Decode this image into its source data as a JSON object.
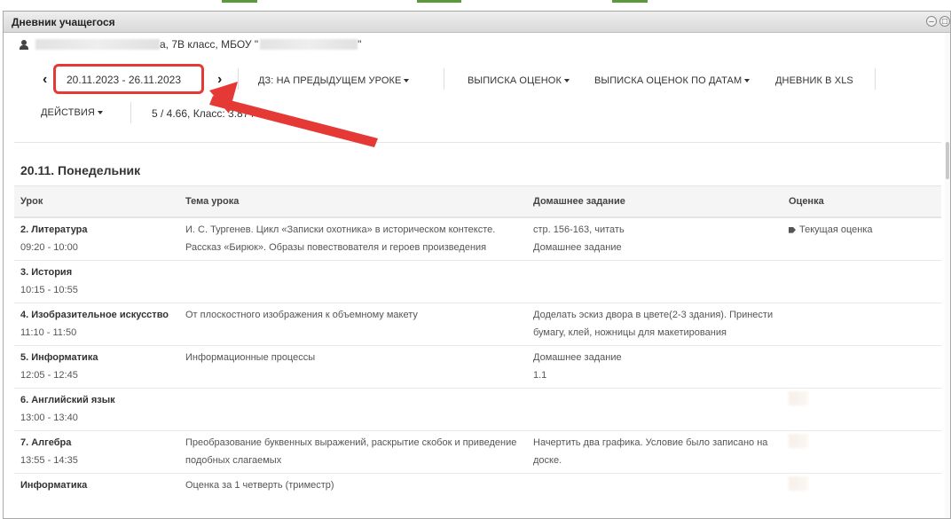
{
  "window": {
    "title": "Дневник учащегося",
    "controls": [
      "minimize",
      "restore"
    ]
  },
  "student": {
    "info_suffix": "а, 7В класс, МБОУ \"",
    "info_end": "\""
  },
  "toolbar": {
    "prev_label": "‹",
    "next_label": "›",
    "date_range": "20.11.2023 - 26.11.2023",
    "menus": [
      {
        "label": "ДЗ: НА ПРЕДЫДУЩЕМ УРОКЕ"
      },
      {
        "label": "ВЫПИСКА ОЦЕНОК"
      },
      {
        "label": "ВЫПИСКА ОЦЕНОК ПО ДАТАМ"
      },
      {
        "label": "ДНЕВНИК В XLS"
      }
    ],
    "actions_label": "ДЕЙСТВИЯ",
    "stats": "5 / 4.66, Класс: 3.87 / 3."
  },
  "day": {
    "title": "20.11. Понедельник"
  },
  "table": {
    "headers": {
      "lesson": "Урок",
      "topic": "Тема урока",
      "homework": "Домашнее задание",
      "grade": "Оценка"
    },
    "rows": [
      {
        "lesson": "2. Литература",
        "time": "09:20 - 10:00",
        "topic": "И. С. Тургенев. Цикл «Записки охотника» в историческом контексте. Рассказ «Бирюк». Образы повествователя и героев произведения",
        "homework": "стр. 156-163, читать",
        "homework2": "Домашнее задание",
        "grade": "Текущая оценка"
      },
      {
        "lesson": "3. История",
        "time": "10:15 - 10:55",
        "topic": "",
        "homework": "",
        "homework2": "",
        "grade": ""
      },
      {
        "lesson": "4. Изобразительное искусство",
        "time": "11:10 - 11:50",
        "topic": "От плоскостного изображения к объемному макету",
        "homework": "Доделать эскиз двора в цвете(2-3 здания). Принести бумагу, клей, ножницы для макетирования",
        "homework2": "",
        "grade": ""
      },
      {
        "lesson": "5. Информатика",
        "time": "12:05 - 12:45",
        "topic": "Информационные процессы",
        "homework": "Домашнее задание",
        "homework2": "1.1",
        "grade": ""
      },
      {
        "lesson": "6. Английский язык",
        "time": "13:00 - 13:40",
        "topic": "",
        "homework": "",
        "homework2": "",
        "grade": ""
      },
      {
        "lesson": "7. Алгебра",
        "time": "13:55 - 14:35",
        "topic": "Преобразование буквенных выражений, раскрытие скобок и приведение подобных слагаемых",
        "homework": "Начертить два графика. Условие было записано на доске.",
        "homework2": "",
        "grade": ""
      },
      {
        "lesson": "Информатика",
        "time": "",
        "topic": "Оценка за 1 четверть (триместр)",
        "homework": "",
        "homework2": "",
        "grade": ""
      }
    ]
  },
  "annotation": {
    "arrow_color": "#e53935"
  }
}
